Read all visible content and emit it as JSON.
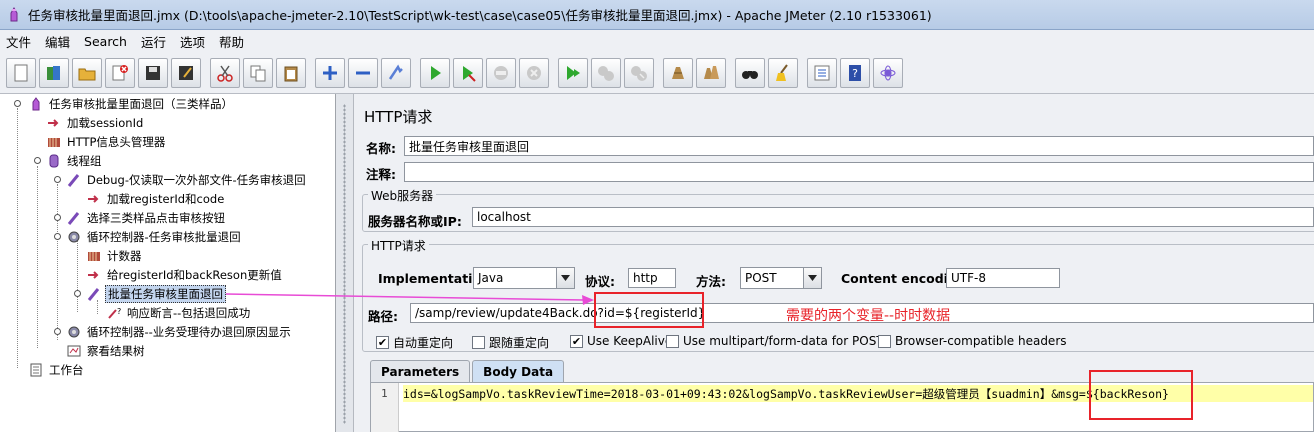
{
  "window": {
    "title": "任务审核批量里面退回.jmx (D:\\tools\\apache-jmeter-2.10\\TestScript\\wk-test\\case\\case05\\任务审核批量里面退回.jmx) - Apache JMeter (2.10 r1533061)"
  },
  "menu": [
    "文件",
    "编辑",
    "Search",
    "运行",
    "选项",
    "帮助"
  ],
  "toolbar": {
    "buttons": [
      "new-icon",
      "templates-icon",
      "open-icon",
      "close-icon",
      "save-icon",
      "save-as-icon",
      "cut-icon",
      "copy-icon",
      "paste-icon",
      "expand-icon",
      "collapse-icon",
      "toggle-icon",
      "start-icon",
      "start-no-pause-icon",
      "stop-icon",
      "shutdown-icon",
      "remote-start-icon",
      "remote-stop-icon",
      "remote-shutdown-icon",
      "clear-icon",
      "clear-all-icon",
      "search-icon",
      "reset-search-icon",
      "function-helper-icon",
      "help-icon",
      "about-icon"
    ]
  },
  "tree": {
    "items": [
      {
        "label": "任务审核批量里面退回（三类样品）",
        "icon": "testplan-icon"
      },
      {
        "label": "加载sessionId",
        "icon": "preprocessor-icon"
      },
      {
        "label": "HTTP信息头管理器",
        "icon": "config-icon"
      },
      {
        "label": "线程组",
        "icon": "threadgroup-icon"
      },
      {
        "label": "Debug-仅读取一次外部文件-任务审核退回",
        "icon": "sampler-icon"
      },
      {
        "label": "加载registerId和code",
        "icon": "preprocessor-icon"
      },
      {
        "label": "选择三类样品点击审核按钮",
        "icon": "sampler-icon"
      },
      {
        "label": "循环控制器-任务审核批量退回",
        "icon": "controller-icon"
      },
      {
        "label": "计数器",
        "icon": "config-icon"
      },
      {
        "label": "给registerId和backReson更新值",
        "icon": "preprocessor-icon"
      },
      {
        "label": "批量任务审核里面退回",
        "icon": "sampler-icon"
      },
      {
        "label": "响应断言--包括退回成功",
        "icon": "assertion-icon"
      },
      {
        "label": "循环控制器--业务受理待办退回原因显示",
        "icon": "controller-icon"
      },
      {
        "label": "察看结果树",
        "icon": "listener-icon"
      },
      {
        "label": "工作台",
        "icon": "workbench-icon"
      }
    ]
  },
  "panel": {
    "title": "HTTP请求",
    "name_label": "名称:",
    "name_value": "批量任务审核里面退回",
    "comment_label": "注释:",
    "comment_value": "",
    "web_server_group": "Web服务器",
    "server_label": "服务器名称或IP:",
    "server_value": "localhost",
    "http_group": "HTTP请求",
    "impl_label": "Implementation:",
    "impl_value": "Java",
    "protocol_label": "协议:",
    "protocol_value": "http",
    "method_label": "方法:",
    "method_value": "POST",
    "encoding_label": "Content encoding:",
    "encoding_value": "UTF-8",
    "path_label": "路径:",
    "path_value": "/samp/review/update4Back.do?id=${registerId}",
    "checkboxes": [
      {
        "label": "自动重定向",
        "checked": true
      },
      {
        "label": "跟随重定向",
        "checked": false
      },
      {
        "label": "Use KeepAlive",
        "checked": true
      },
      {
        "label": "Use multipart/form-data for POST",
        "checked": false
      },
      {
        "label": "Browser-compatible headers",
        "checked": false
      }
    ],
    "tabs": [
      "Parameters",
      "Body Data"
    ],
    "active_tab": "Body Data",
    "body_line_number": "1",
    "body_data": "ids=&logSampVo.taskReviewTime=2018-03-01+09:43:02&logSampVo.taskReviewUser=超级管理员【suadmin】&msg=${backReson}"
  },
  "annotation": {
    "text": "需要的两个变量--时时数据"
  },
  "colors": {
    "annotation_red": "#e8232a",
    "arrow_magenta": "#e84bd6",
    "selection": "#c3d5ee"
  }
}
